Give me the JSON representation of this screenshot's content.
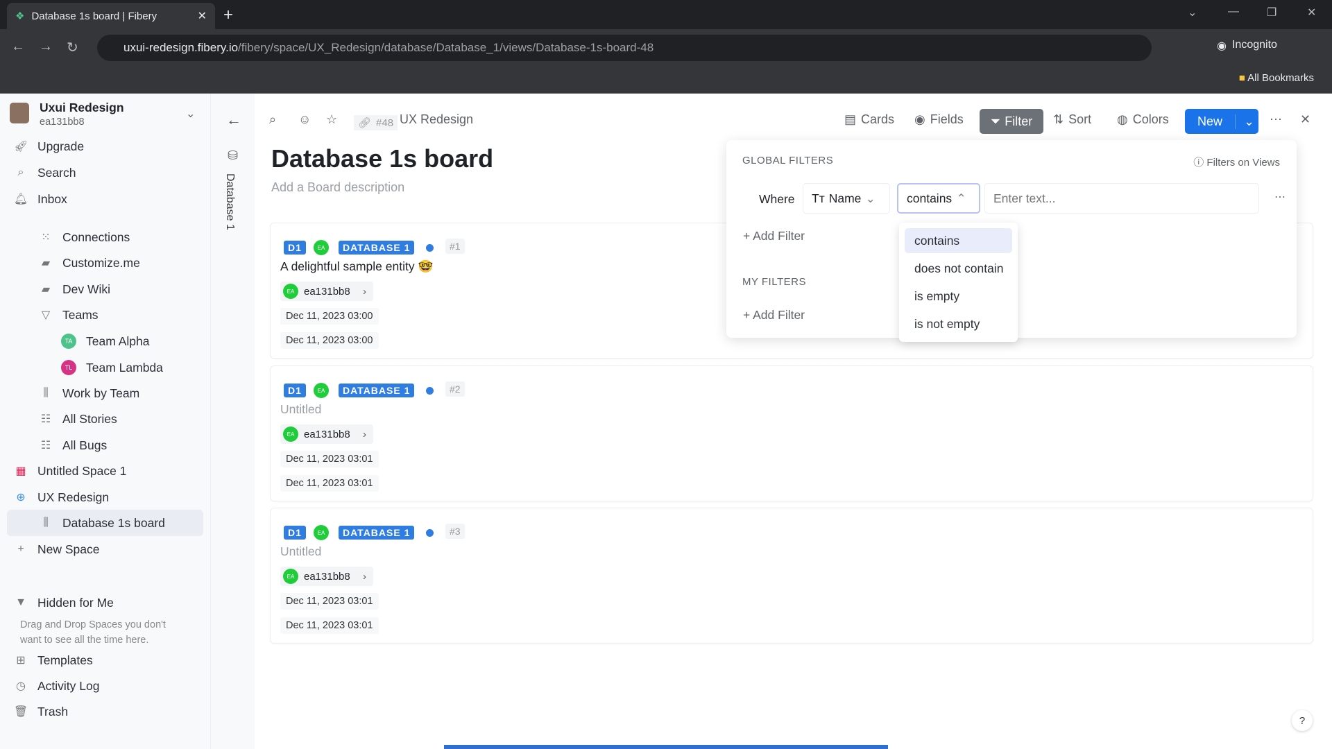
{
  "browser": {
    "tab_title": "Database 1s board | Fibery",
    "url_host": "uxui-redesign.fibery.io",
    "url_path": "/fibery/space/UX_Redesign/database/Database_1/views/Database-1s-board-48",
    "profile": "Incognito",
    "bookmarks": "All Bookmarks"
  },
  "workspace": {
    "name": "Uxui Redesign",
    "user": "ea131bb8"
  },
  "sidebar": {
    "top": [
      {
        "label": "Upgrade",
        "icon": "rocket-icon"
      },
      {
        "label": "Search",
        "icon": "search-icon"
      },
      {
        "label": "Inbox",
        "icon": "bell-icon"
      }
    ],
    "items": [
      {
        "label": "Connections",
        "icon": "connections-icon"
      },
      {
        "label": "Customize.me",
        "icon": "document-icon"
      },
      {
        "label": "Dev Wiki",
        "icon": "document-icon"
      },
      {
        "label": "Teams",
        "icon": "triangle-down-icon"
      },
      {
        "label": "Team Alpha",
        "avatar": "TA",
        "color": "#4cc38a"
      },
      {
        "label": "Team Lambda",
        "avatar": "TL",
        "color": "#d63384"
      },
      {
        "label": "Work by Team",
        "icon": "board-icon"
      },
      {
        "label": "All Stories",
        "icon": "grid-icon"
      },
      {
        "label": "All Bugs",
        "icon": "grid-icon"
      },
      {
        "label": "Untitled Space 1",
        "icon": "space-icon"
      },
      {
        "label": "UX Redesign",
        "icon": "globe-icon"
      },
      {
        "label": "Database 1s board",
        "icon": "board-icon"
      },
      {
        "label": "New Space",
        "icon": "plus-icon"
      }
    ],
    "hidden": {
      "label": "Hidden for Me",
      "hint": "Drag and Drop Spaces you don't want to see all the time here."
    },
    "bottom": [
      {
        "label": "Templates"
      },
      {
        "label": "Activity Log"
      },
      {
        "label": "Trash"
      }
    ]
  },
  "view": {
    "db_label": "Database 1",
    "view_id": "#48",
    "breadcrumb": "UX Redesign",
    "title": "Database 1s board",
    "description": "Add a Board description",
    "toolbar": {
      "cards": "Cards",
      "fields": "Fields",
      "filter": "Filter",
      "sort": "Sort",
      "colors": "Colors",
      "new": "New"
    }
  },
  "cards": [
    {
      "tag": "D1",
      "avatar": "EA",
      "db": "DATABASE 1",
      "num": "#1",
      "name": "A delightful sample entity 🤓",
      "owner": "ea131bb8",
      "date1": "Dec 11, 2023 03:00",
      "date2": "Dec 11, 2023 03:00",
      "placeholder": false
    },
    {
      "tag": "D1",
      "avatar": "EA",
      "db": "DATABASE 1",
      "num": "#2",
      "name": "Untitled",
      "owner": "ea131bb8",
      "date1": "Dec 11, 2023 03:01",
      "date2": "Dec 11, 2023 03:01",
      "placeholder": true
    },
    {
      "tag": "D1",
      "avatar": "EA",
      "db": "DATABASE 1",
      "num": "#3",
      "name": "Untitled",
      "owner": "ea131bb8",
      "date1": "Dec 11, 2023 03:01",
      "date2": "Dec 11, 2023 03:01",
      "placeholder": true
    }
  ],
  "filters": {
    "global_label": "GLOBAL FILTERS",
    "filters_on_views": "Filters on Views",
    "where": "Where",
    "field": "Name",
    "operator": "contains",
    "text_placeholder": "Enter text...",
    "add_filter": "Add Filter",
    "my_label": "MY FILTERS",
    "operator_options": [
      "contains",
      "does not contain",
      "is empty",
      "is not empty"
    ],
    "selected_option": 0
  },
  "colors": {
    "accent": "#1a73e8",
    "badge": "#2f7de1",
    "avatar_green": "#1fcc3a"
  }
}
